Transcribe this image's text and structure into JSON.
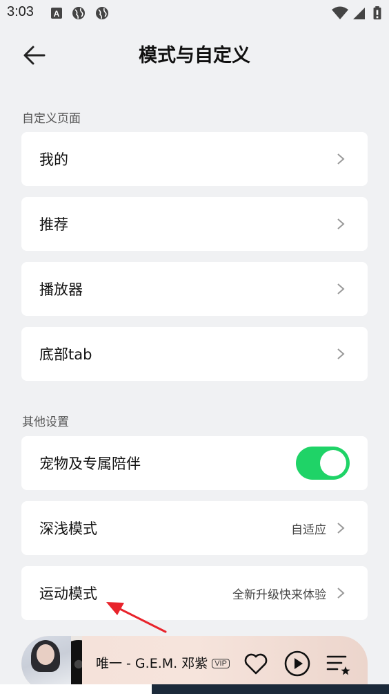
{
  "status_bar": {
    "time": "3:03"
  },
  "header": {
    "title": "模式与自定义",
    "back_icon": "arrow-left-icon"
  },
  "sections": [
    {
      "label": "自定义页面",
      "items": [
        {
          "label": "我的"
        },
        {
          "label": "推荐"
        },
        {
          "label": "播放器"
        },
        {
          "label": "底部tab"
        }
      ]
    },
    {
      "label": "其他设置",
      "items": [
        {
          "label": "宠物及专属陪伴",
          "toggle": true
        },
        {
          "label": "深浅模式",
          "value": "自适应"
        },
        {
          "label": "运动模式",
          "value": "全新升级快来体验"
        }
      ]
    }
  ],
  "player": {
    "song": "唯一 - G.E.M. 邓紫",
    "vip_badge": "VIP",
    "buttons": [
      "heart-icon",
      "play-icon",
      "playlist-icon"
    ]
  },
  "colors": {
    "accent_green": "#1fd367",
    "annotation_red": "#e8232b"
  }
}
